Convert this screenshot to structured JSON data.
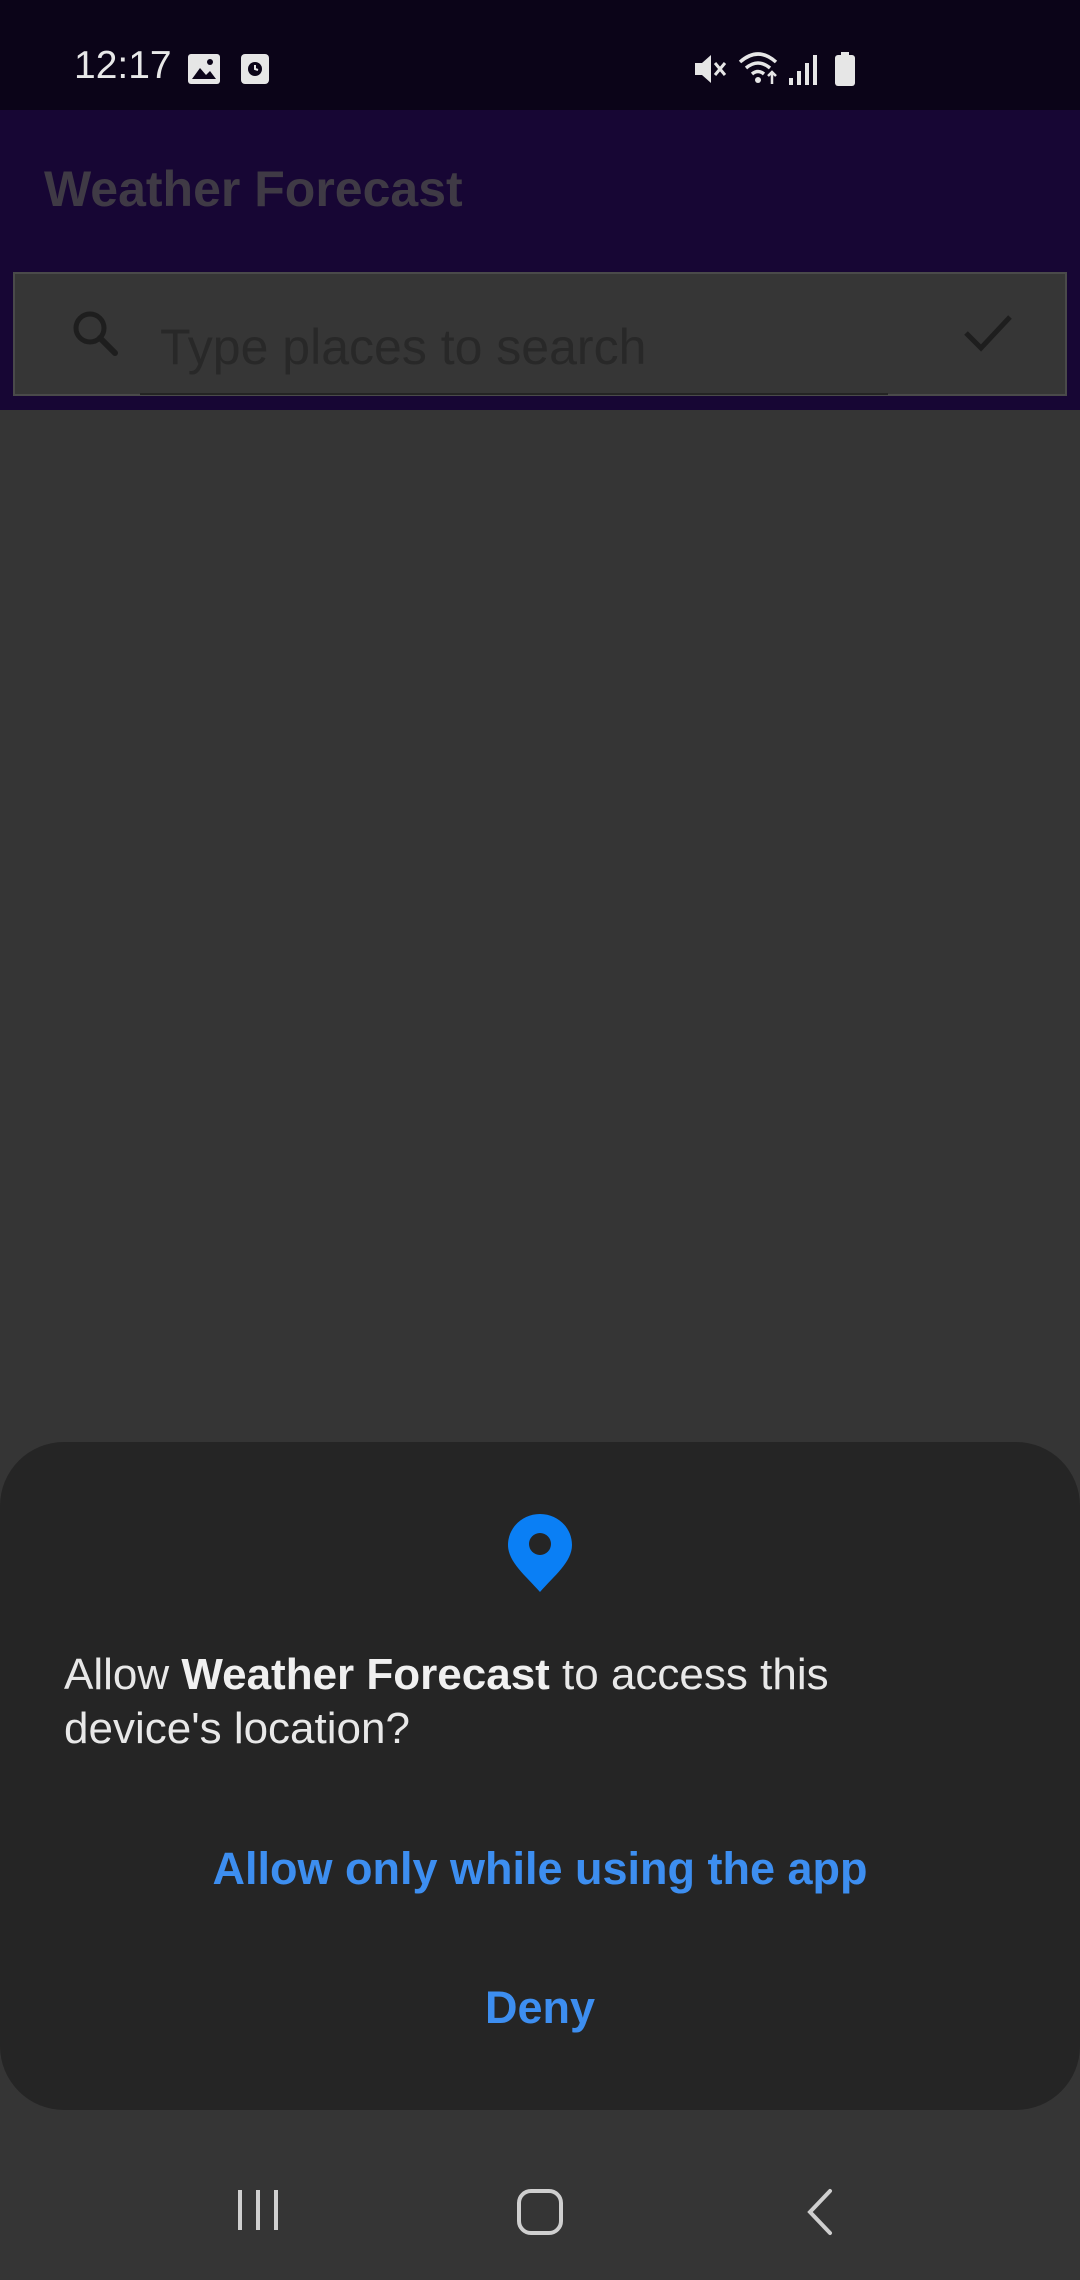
{
  "status_bar": {
    "time": "12:17",
    "left_icons": [
      "image-icon",
      "screen-record-icon"
    ],
    "right_icons": [
      "mute-icon",
      "wifi-icon",
      "signal-icon",
      "battery-icon"
    ]
  },
  "app": {
    "title": "Weather Forecast",
    "search_placeholder": "Type places to search",
    "search_value": ""
  },
  "dialog": {
    "icon": "location-pin-icon",
    "message_prefix": "Allow ",
    "app_name": "Weather Forecast",
    "message_suffix": " to access this device's location?",
    "allow_label": "Allow only while using the app",
    "deny_label": "Deny"
  },
  "nav_bar": {
    "buttons": [
      "recent-apps-icon",
      "home-icon",
      "back-icon"
    ]
  },
  "colors": {
    "accent": "#3d8ef0",
    "location_pin": "#0a7ff5",
    "status_bar_bg": "#0b0418",
    "app_bar_bg": "#170634",
    "dialog_bg": "#252525",
    "scrim_bg": "#353535"
  }
}
